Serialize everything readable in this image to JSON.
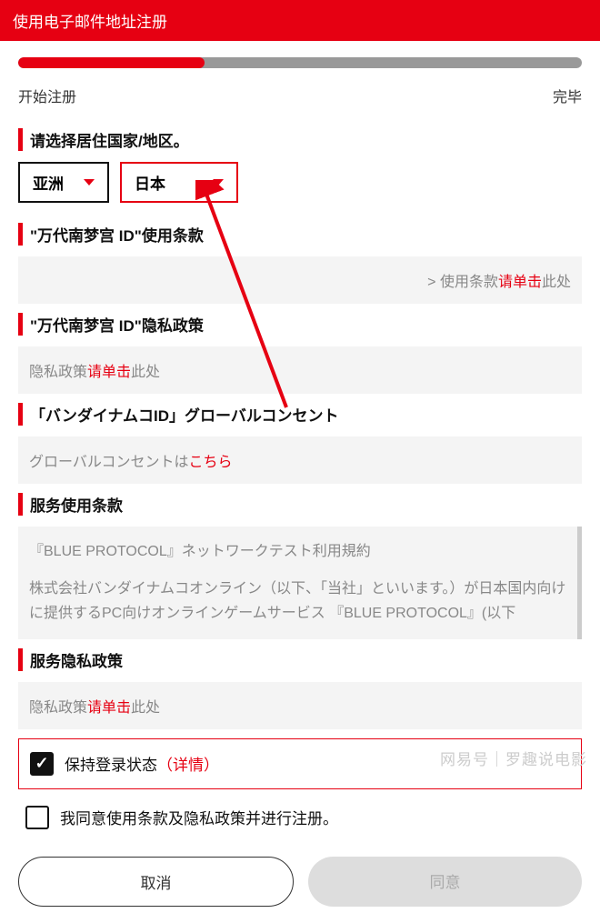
{
  "header": {
    "title": "使用电子邮件地址注册"
  },
  "progress": {
    "start": "开始注册",
    "end": "完毕"
  },
  "region": {
    "title": "请选择居住国家/地区。",
    "continent": "亚洲",
    "country": "日本"
  },
  "sections": {
    "terms_of_use": {
      "title": "\"万代南梦宫 ID\"使用条款",
      "prefix": "> 使用条款",
      "link": "请单击",
      "suffix": "此处"
    },
    "privacy_policy": {
      "title": "\"万代南梦宫 ID\"隐私政策",
      "prefix": "隐私政策",
      "link": "请单击",
      "suffix": "此处"
    },
    "global_consent": {
      "title": "「バンダイナムコID」グローバルコンセント",
      "prefix": "グローバルコンセントは",
      "link": "こちら"
    },
    "service_terms": {
      "title": "服务使用条款",
      "line1": "『BLUE PROTOCOL』ネットワークテスト利用規約",
      "line2": "株式会社バンダイナムコオンライン（以下、「当社」といいます。）が日本国内向けに提供するPC向けオンラインゲームサービス 『BLUE PROTOCOL』(以下"
    },
    "service_privacy": {
      "title": "服务隐私政策",
      "prefix": "隐私政策",
      "link": "请单击",
      "suffix": "此处"
    }
  },
  "checkboxes": {
    "stay_logged": {
      "label": "保持登录状态",
      "detail_open": "（",
      "detail": "详情",
      "detail_close": "）"
    },
    "agree": {
      "label": "我同意使用条款及隐私政策并进行注册。"
    }
  },
  "buttons": {
    "cancel": "取消",
    "agree": "同意"
  },
  "watermark": "网易号｜罗趣说电影"
}
